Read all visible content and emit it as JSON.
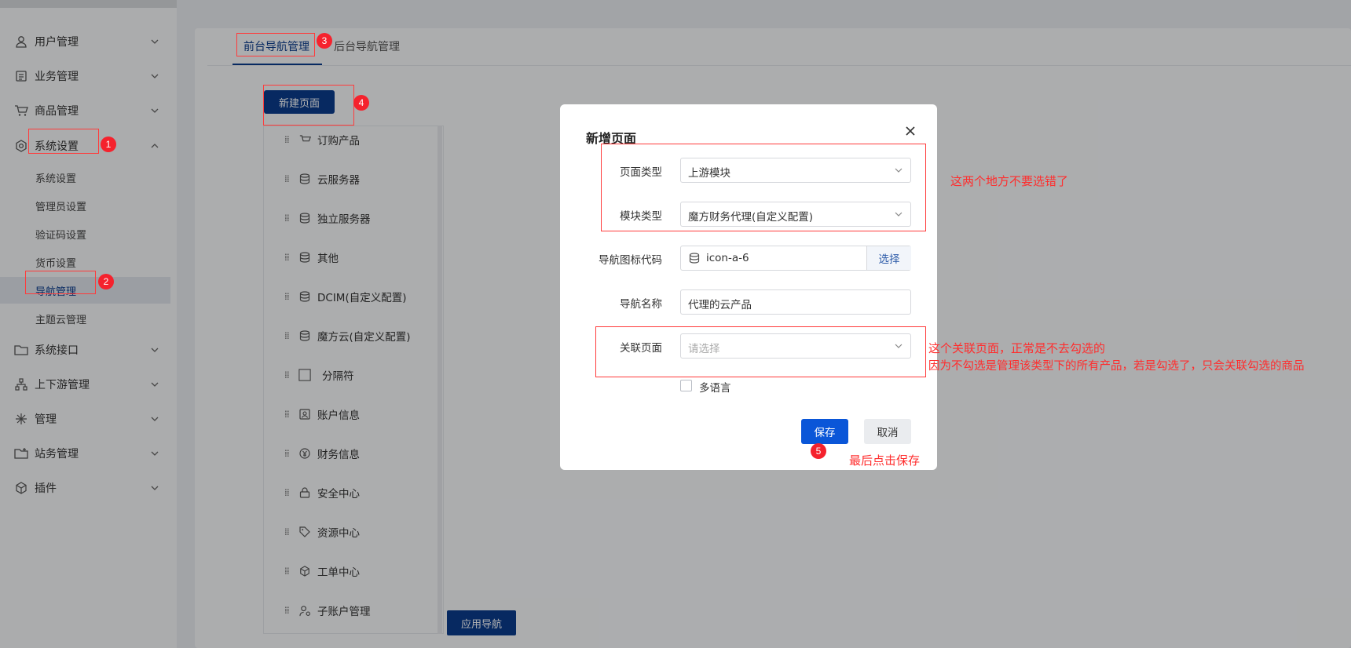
{
  "sidebar": {
    "menus": [
      {
        "label": "用户管理",
        "icon": "user-icon"
      },
      {
        "label": "业务管理",
        "icon": "document-icon"
      },
      {
        "label": "商品管理",
        "icon": "cart-icon"
      },
      {
        "label": "系统设置",
        "icon": "gear-icon"
      },
      {
        "label": "系统接口",
        "icon": "folder-icon"
      },
      {
        "label": "上下游管理",
        "icon": "hierarchy-icon"
      },
      {
        "label": "管理",
        "icon": "asterisk-icon"
      },
      {
        "label": "站务管理",
        "icon": "folder-plus-icon"
      },
      {
        "label": "插件",
        "icon": "cube-icon"
      }
    ],
    "submenu": [
      {
        "label": "系统设置"
      },
      {
        "label": "管理员设置"
      },
      {
        "label": "验证码设置"
      },
      {
        "label": "货币设置"
      },
      {
        "label": "导航管理"
      },
      {
        "label": "主题云管理"
      }
    ]
  },
  "tabs": [
    {
      "label": "前台导航管理"
    },
    {
      "label": "后台导航管理"
    }
  ],
  "new_page_button": "新建页面",
  "apply_nav_button": "应用导航",
  "nav_items": [
    {
      "label": "订购产品",
      "icon": "cart-icon"
    },
    {
      "label": "云服务器",
      "icon": "database-icon"
    },
    {
      "label": "独立服务器",
      "icon": "database-icon"
    },
    {
      "label": "其他",
      "icon": "database-icon"
    },
    {
      "label": "DCIM(自定义配置)",
      "icon": "database-icon"
    },
    {
      "label": "魔方云(自定义配置)",
      "icon": "database-icon"
    },
    {
      "label": "分隔符",
      "icon": "square-icon"
    },
    {
      "label": "账户信息",
      "icon": "id-card-icon"
    },
    {
      "label": "财务信息",
      "icon": "yen-icon"
    },
    {
      "label": "安全中心",
      "icon": "lock-icon"
    },
    {
      "label": "资源中心",
      "icon": "tag-icon"
    },
    {
      "label": "工单中心",
      "icon": "box-icon"
    },
    {
      "label": "子账户管理",
      "icon": "user-gear-icon"
    }
  ],
  "modal": {
    "title": "新增页面",
    "page_type_label": "页面类型",
    "page_type_value": "上游模块",
    "module_type_label": "模块类型",
    "module_type_value": "魔方财务代理(自定义配置)",
    "icon_code_label": "导航图标代码",
    "icon_code_value": "icon-a-6",
    "choose_button": "选择",
    "nav_name_label": "导航名称",
    "nav_name_value": "代理的云产品",
    "related_page_label": "关联页面",
    "related_page_placeholder": "请选择",
    "multilang_label": "多语言",
    "save_button": "保存",
    "cancel_button": "取消"
  },
  "annotations": {
    "badges": [
      "1",
      "2",
      "3",
      "4",
      "5"
    ],
    "note_top": "这两个地方不要选错了",
    "note_related_1": "这个关联页面，正常是不去勾选的",
    "note_related_2": "因为不勾选是管理该类型下的所有产品，若是勾选了，只会关联勾选的商品",
    "note_save": "最后点击保存",
    "color": "#ff2d2d"
  },
  "colors": {
    "primary": "#0b3c8c",
    "save_blue": "#0a56d8",
    "badge_red": "#f5222d"
  }
}
